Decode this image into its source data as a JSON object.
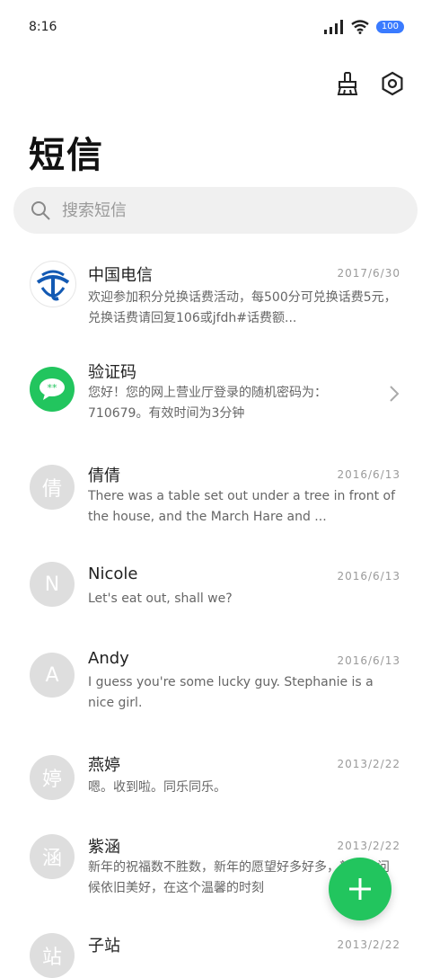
{
  "status": {
    "time": "8:16",
    "battery": "100"
  },
  "header": {
    "title": "短信"
  },
  "search": {
    "placeholder": "搜索短信"
  },
  "messages": [
    {
      "name": "中国电信",
      "date": "2017/6/30",
      "preview": "欢迎参加积分兑换话费活动，每500分可兑换话费5元，兑换话费请回复106或jfdh#话费额...",
      "avatar": ""
    },
    {
      "name": "验证码",
      "date": "",
      "preview": "您好！您的网上营业厅登录的随机密码为：710679。有效时间为3分钟",
      "avatar": "**"
    },
    {
      "name": "倩倩",
      "date": "2016/6/13",
      "preview": "There was a table set out under a tree in front of the house, and the March Hare and ...",
      "avatar": "倩"
    },
    {
      "name": "Nicole",
      "date": "2016/6/13",
      "preview": "Let's eat out, shall we?",
      "avatar": "N"
    },
    {
      "name": "Andy",
      "date": "2016/6/13",
      "preview": "I guess you're some lucky guy. Stephanie is a nice girl.",
      "avatar": "A"
    },
    {
      "name": "燕婷",
      "date": "2013/2/22",
      "preview": "嗯。收到啦。同乐同乐。",
      "avatar": "婷"
    },
    {
      "name": "紫涵",
      "date": "2013/2/22",
      "preview": "新年的祝福数不胜数，新年的愿望好多好多，新年的问候依旧美好，在这个温馨的时刻",
      "avatar": "涵"
    },
    {
      "name": "子站",
      "date": "2013/2/22",
      "preview": "",
      "avatar": "站"
    }
  ],
  "colors": {
    "accent": "#22c55e",
    "telecom": "#1259b3",
    "battery": "#3a7bff"
  }
}
